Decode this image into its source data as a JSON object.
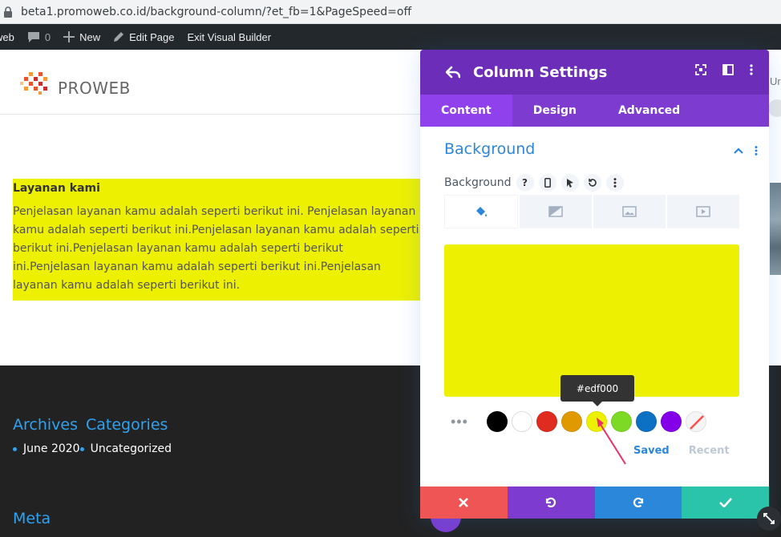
{
  "browser": {
    "url": "beta1.promoweb.co.id/background-column/?et_fb=1&PageSpeed=off"
  },
  "adminbar": {
    "site": "web",
    "comments_count": "0",
    "new_label": "New",
    "edit_page_label": "Edit Page",
    "exit_label": "Exit Visual Builder"
  },
  "site": {
    "logo_text": "PROWEB"
  },
  "content": {
    "heading": "Layanan kami",
    "paragraph": "Penjelasan layanan kamu adalah seperti berikut ini. Penjelasan layanan kamu adalah seperti berikut ini.Penjelasan layanan kamu adalah seperti berikut ini.Penjelasan layanan kamu adalah seperti berikut ini.Penjelasan layanan kamu adalah seperti berikut ini.Penjelasan layanan kamu adalah seperti berikut ini.",
    "bg_color": "#edf000"
  },
  "footer": {
    "archives_label": "Archives",
    "categories_label": "Categories",
    "archive_link": "June 2020",
    "category_link": "Uncategorized",
    "meta_label": "Meta"
  },
  "modal": {
    "title": "Column Settings",
    "tabs": [
      {
        "label": "Content",
        "active": true
      },
      {
        "label": "Design",
        "active": false
      },
      {
        "label": "Advanced",
        "active": false
      }
    ],
    "section_title": "Background",
    "field_label": "Background",
    "help_glyph": "?",
    "background_types": [
      "color-fill-icon",
      "gradient-icon",
      "image-icon",
      "video-icon"
    ],
    "selected_color": "#edf000",
    "tooltip": "#edf000",
    "swatches": [
      "#000000",
      "#ffffff",
      "#e02b20",
      "#e09900",
      "#edf000",
      "#7cda24",
      "#0c71c3",
      "#8300e9",
      "none"
    ],
    "saved_label": "Saved",
    "recent_label": "Recent",
    "footer_colors": {
      "discard": "#ef5555",
      "undo": "#7e3bd0",
      "redo": "#2b87da",
      "save": "#29c4a9"
    }
  },
  "right_clip": {
    "letter": "Ur"
  }
}
